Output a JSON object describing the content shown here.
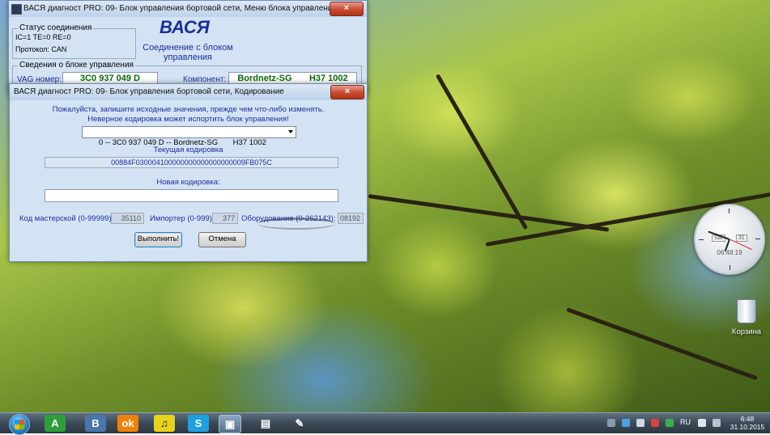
{
  "main_window": {
    "title": "ВАСЯ диагност PRO: 09- Блок управления бортовой сети,  Меню блока управления",
    "close": "×",
    "status_group_label": "Статус соединения",
    "status_line": "IC=1  TE=0   RE=0",
    "protocol": "Протокол: CAN",
    "brand": "ВАСЯ",
    "connection_text": "Соединение с блоком управления",
    "info_group_label": "Сведения о блоке управления",
    "vag_label": "VAG номер:",
    "vag_value": "3C0 937 049 D",
    "component_label": "Компонент:",
    "component_value": "Bordnetz-SG       H37 1002"
  },
  "coding_dialog": {
    "title": "ВАСЯ диагност PRO: 09- Блок управления бортовой сети,  Кодирование",
    "close": "×",
    "warning_line1": "Пожалуйста, запишите исходные значения, прежде чем что-либо изменять.",
    "warning_line2": "Неверное кодировка может испортить блок управления!",
    "module_select": "0 -- 3C0 937 049 D -- Bordnetz-SG       H37 1002",
    "current_coding_label": "Текущая кодировка",
    "current_coding_value": "00884F030004100000000000000000009FB075C",
    "new_coding_label": "Новая кодировка:",
    "new_coding_value": "",
    "workshop_label": "Код мастерской (0-99999):",
    "workshop_value": "35110",
    "importer_label": "Импортер (0-999):",
    "importer_value": "377",
    "equipment_label": "Оборудование (0-262143):",
    "equipment_value": "08192",
    "execute_button": "Выполнить!",
    "cancel_button": "Отмена"
  },
  "clock_gadget": {
    "day": "Sat",
    "date": "31",
    "time": "06:48:19"
  },
  "desktop": {
    "recycle_bin_label": "Корзина"
  },
  "taskbar": {
    "apps": [
      {
        "name": "A",
        "color": "#2e9e3a"
      },
      {
        "name": "B",
        "color": "#4a76a8"
      },
      {
        "name": "ok",
        "color": "#ee8208"
      },
      {
        "name": "music",
        "color": "#e8d31a"
      },
      {
        "name": "S",
        "color": "#1ea0e0"
      }
    ],
    "clock_time": "6:48",
    "clock_date": "31.10.2015",
    "language": "RU"
  }
}
